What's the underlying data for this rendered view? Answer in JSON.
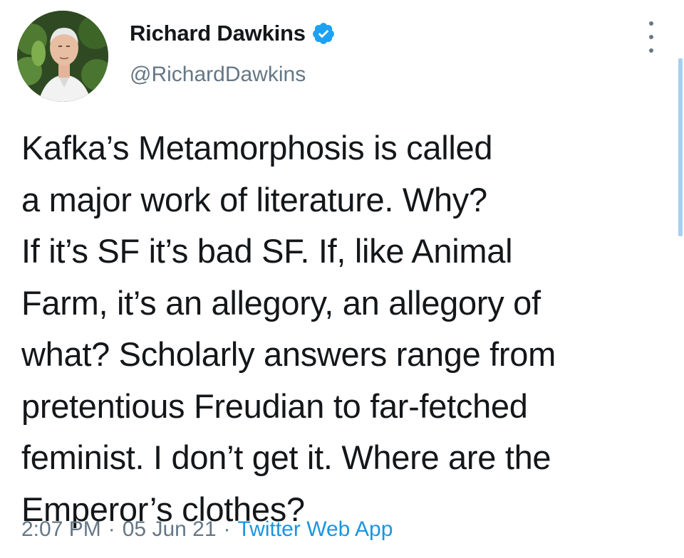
{
  "author": {
    "display_name": "Richard Dawkins",
    "handle": "@RichardDawkins",
    "verified": true,
    "verified_icon": "verified-badge-icon"
  },
  "tweet": {
    "text": "Kafka’s Metamorphosis is called\na major work of literature. Why?\nIf it’s SF it’s bad SF. If, like Animal\nFarm, it’s an allegory, an allegory of\nwhat? Scholarly answers range from\npretentious Freudian to far-fetched\nfeminist. I don’t get it. Where are the\nEmperor’s clothes?"
  },
  "meta": {
    "time": "2:07 PM",
    "separator": "·",
    "date": "05 Jun 21",
    "source": "Twitter Web App"
  },
  "colors": {
    "text": "#14171a",
    "secondary": "#657786",
    "link": "#1b95e0",
    "verified": "#1da1f2"
  },
  "icons": {
    "more": "more-options-icon"
  }
}
